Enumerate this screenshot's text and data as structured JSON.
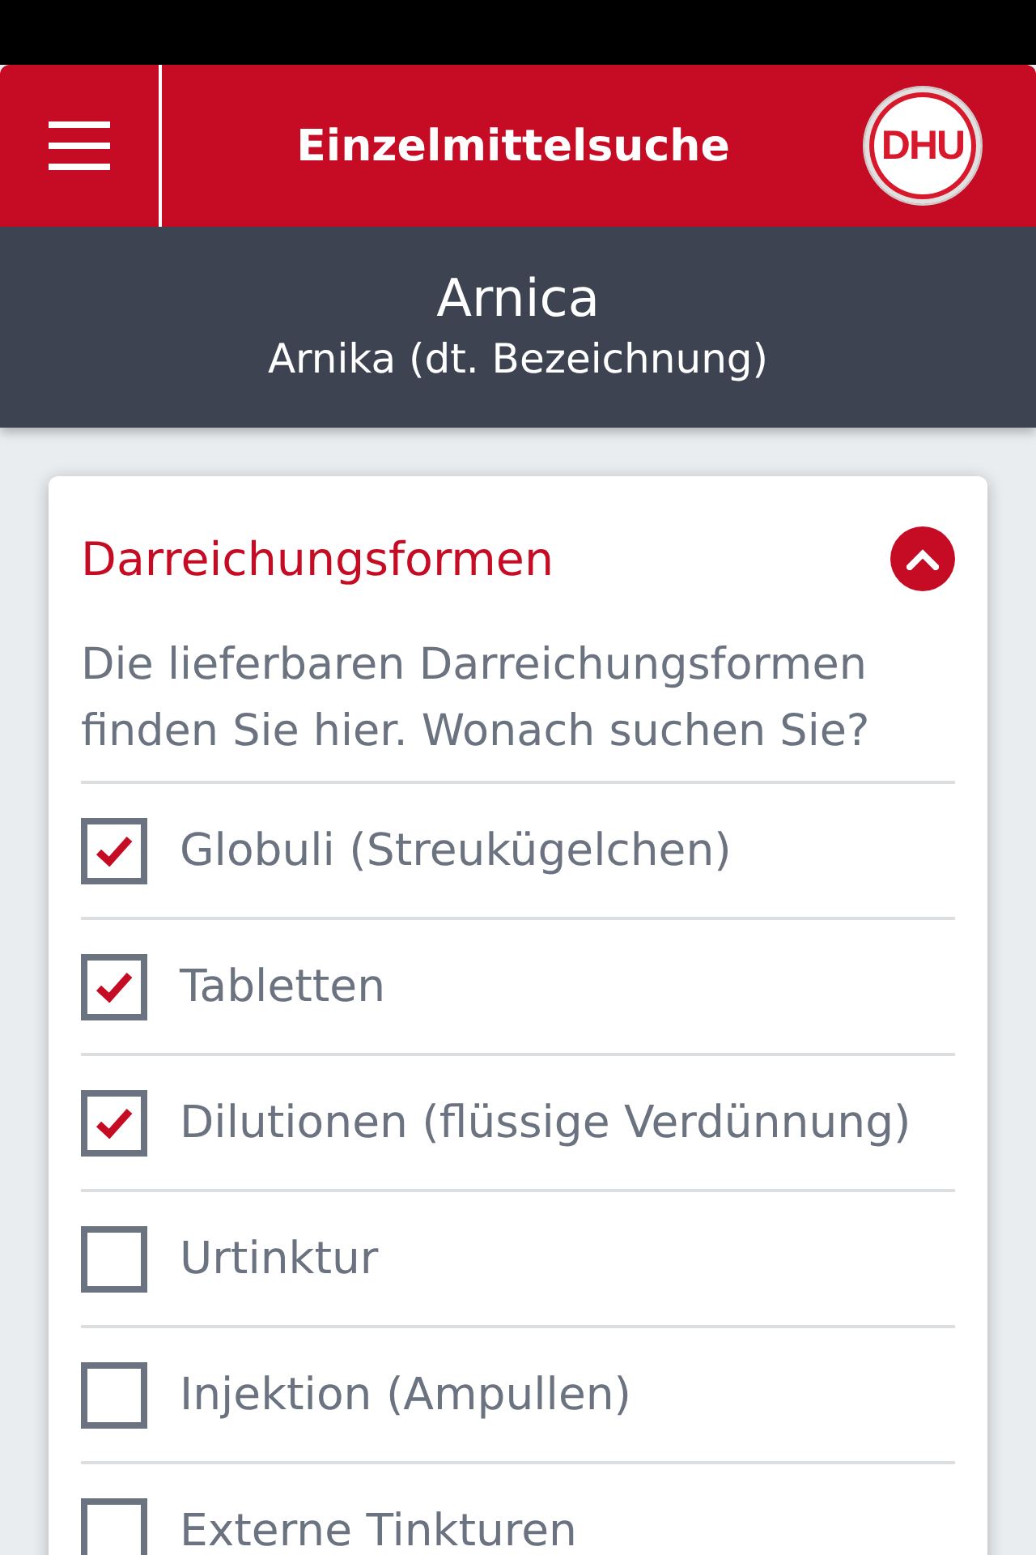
{
  "header": {
    "title": "Einzelmittelsuche",
    "logo_text": "DHU"
  },
  "subheader": {
    "name": "Arnica",
    "subtitle": "Arnika (dt. Bezeichnung)"
  },
  "section": {
    "title": "Darreichungsformen",
    "expanded": true,
    "description": "Die lieferbaren Darreichungsformen finden Sie hier. Wonach suchen Sie?",
    "options": [
      {
        "label": "Globuli (Streukügelchen)",
        "checked": true
      },
      {
        "label": "Tabletten",
        "checked": true
      },
      {
        "label": "Dilutionen (flüssige Verdünnung)",
        "checked": true
      },
      {
        "label": "Urtinktur",
        "checked": false
      },
      {
        "label": "Injektion (Ampullen)",
        "checked": false
      },
      {
        "label": "Externe Tinkturen",
        "checked": false
      }
    ]
  }
}
